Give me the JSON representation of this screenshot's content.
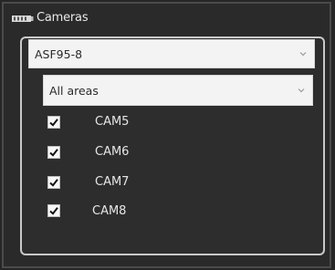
{
  "panel": {
    "title": "Cameras",
    "title_icon": "camera-strip-icon"
  },
  "site_select": {
    "value": "ASF95-8",
    "icon": "chevron-down-icon"
  },
  "area_select": {
    "value": "All areas",
    "icon": "chevron-down-icon"
  },
  "cameras": [
    {
      "label": "CAM5",
      "checked": true
    },
    {
      "label": "CAM6",
      "checked": true
    },
    {
      "label": "CAM7",
      "checked": true
    },
    {
      "label": "CAM8",
      "checked": true
    }
  ],
  "colors": {
    "background": "#262626",
    "frame_border": "#c9c9c9",
    "text": "#e6e6e6",
    "checkmark": "#111111"
  }
}
